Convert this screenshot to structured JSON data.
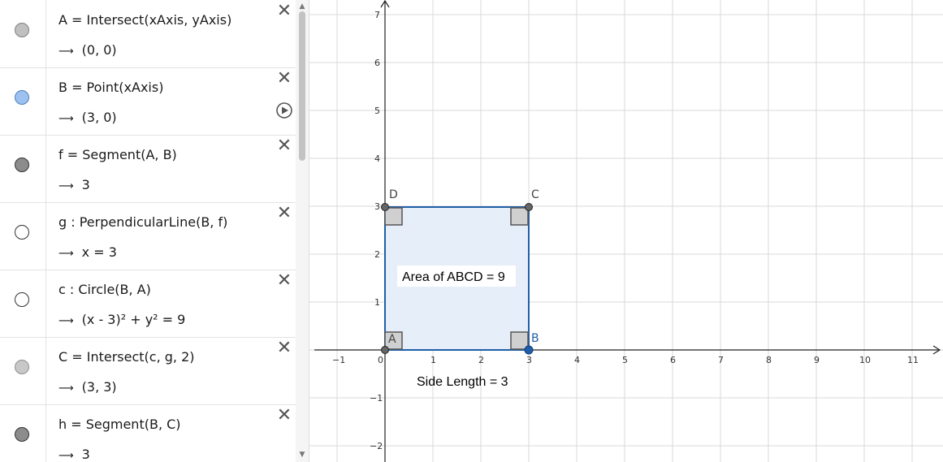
{
  "algebra": {
    "items": [
      {
        "definition": "A = Intersect(xAxis, yAxis)",
        "value": "(0, 0)",
        "marble_color": "#c0c0c0",
        "marble_border": "#808080"
      },
      {
        "definition": "B = Point(xAxis)",
        "value": "(3, 0)",
        "marble_color": "#9dc2f0",
        "marble_border": "#4a7fc0",
        "has_play": true
      },
      {
        "definition": "f = Segment(A, B)",
        "value": "3",
        "marble_color": "#8c8c8c",
        "marble_border": "#333333"
      },
      {
        "definition": "g : PerpendicularLine(B, f)",
        "value": "x = 3",
        "marble_color": "#ffffff",
        "marble_border": "#333333"
      },
      {
        "definition": "c : Circle(B, A)",
        "value": "(x - 3)² + y² = 9",
        "marble_color": "#ffffff",
        "marble_border": "#333333"
      },
      {
        "definition": "C = Intersect(c, g, 2)",
        "value": "(3, 3)",
        "marble_color": "#c8c8c8",
        "marble_border": "#909090"
      },
      {
        "definition": "h = Segment(B, C)",
        "value": "3",
        "marble_color": "#8c8c8c",
        "marble_border": "#333333"
      }
    ]
  },
  "graphics": {
    "x_ticks": [
      "−1",
      "0",
      "1",
      "2",
      "3",
      "4",
      "5",
      "6",
      "7",
      "8",
      "9",
      "10",
      "11"
    ],
    "y_ticks": [
      "7",
      "6",
      "5",
      "4",
      "3",
      "2",
      "1",
      "−1",
      "−2"
    ],
    "points": {
      "A": "A",
      "B": "B",
      "C": "C",
      "D": "D"
    },
    "area_text": "Area of  ABCD = 9",
    "side_text": "Side Length = 3",
    "colors": {
      "square_stroke": "#1f5fa8",
      "square_fill": "#e6eefa",
      "point_b": "#1f5fa8"
    }
  }
}
